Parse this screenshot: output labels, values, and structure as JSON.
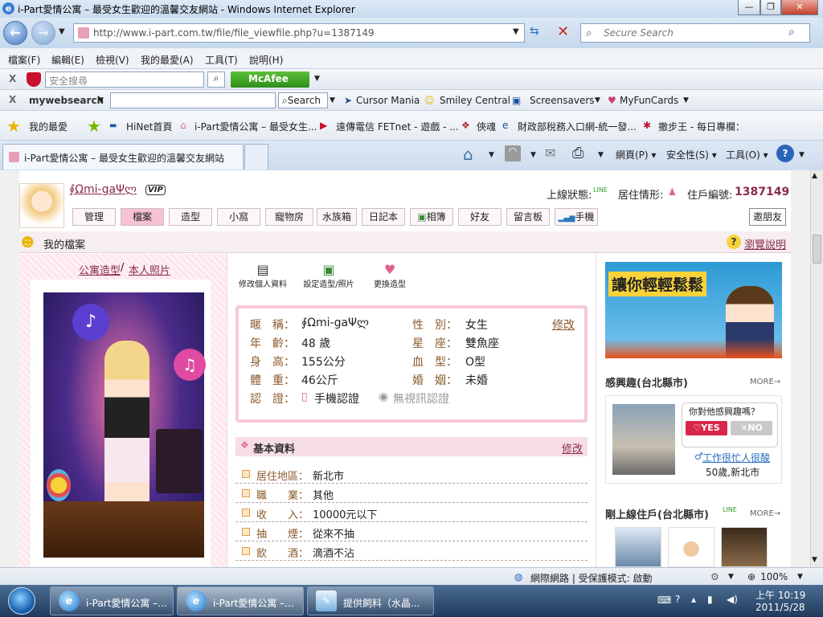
{
  "window": {
    "title": "i-Part愛情公寓 – 最受女生歡迎的溫馨交友網站 - Windows Internet Explorer"
  },
  "address": {
    "url": "http://www.i-part.com.tw/file/file_viewfile.php?u=1387149",
    "search_placeholder": "Secure Search"
  },
  "menu": [
    "檔案(F)",
    "編輯(E)",
    "檢視(V)",
    "我的最愛(A)",
    "工具(T)",
    "說明(H)"
  ],
  "toolbar1": {
    "search_placeholder": "安全搜尋",
    "mcafee": "McAfee"
  },
  "toolbar2": {
    "brand": "mywebsearch",
    "search_btn": "Search",
    "cursor": "Cursor Mania",
    "smiley": "Smiley Central",
    "screensavers": "Screensavers",
    "funcards": "MyFunCards"
  },
  "favbar": {
    "favorites": "我的最愛",
    "items": [
      "HiNet首頁",
      "i-Part愛情公寓 – 最受女生...",
      "遠傳電信 FETnet - 遊戲 - ...",
      "俠魂",
      "財政部稅務入口網-統一發...",
      "撤步王 - 每日專欄："
    ]
  },
  "tabs": {
    "active": "i-Part愛情公寓 – 最受女生歡迎的溫馨交友網站",
    "page_menu": "網頁(P)",
    "safety_menu": "安全性(S)",
    "tools_menu": "工具(O)"
  },
  "profile": {
    "name": "∮Ωmi-gaΨლ",
    "vip": "VIP",
    "online_label": "上線狀態:",
    "online_badge": "LINE",
    "residence_label": "居住情形:",
    "id_label": "住戶編號:",
    "id": "1387149"
  },
  "nav": [
    "管理",
    "檔案",
    "造型",
    "小窩",
    "寵物房",
    "水族箱",
    "日記本",
    "相簿",
    "好友",
    "留言板",
    "手機"
  ],
  "invite": "邀朋友",
  "file_title": "我的檔案",
  "browse_help": "瀏覽說明",
  "left": {
    "tab_style": "公寓造型",
    "tab_photo": "本人照片"
  },
  "actions": [
    "修改個人資料",
    "設定造型/照片",
    "更換造型"
  ],
  "info": {
    "nickname_label": "暱　稱：",
    "nickname": "∮Ωmi-gaΨლ",
    "gender_label": "性　別：",
    "gender": "女生",
    "edit": "修改",
    "age_label": "年　齡：",
    "age": "48 歲",
    "sign_label": "星　座：",
    "sign": "雙魚座",
    "height_label": "身　高：",
    "height": "155公分",
    "blood_label": "血　型：",
    "blood": "O型",
    "weight_label": "體　重：",
    "weight": "46公斤",
    "marital_label": "婚　姻：",
    "marital": "未婚",
    "verify_label": "認　證：",
    "phone_verify": "手機認證",
    "video_verify": "無視訊認證"
  },
  "basic": {
    "title": "基本資料",
    "edit": "修改",
    "rows": [
      {
        "label": "居住地區：",
        "value": "新北市"
      },
      {
        "label": "職　　業：",
        "value": "其他"
      },
      {
        "label": "收　　入：",
        "value": "10000元以下"
      },
      {
        "label": "抽　　煙：",
        "value": "從來不抽"
      },
      {
        "label": "飲　　酒：",
        "value": "滴酒不沾"
      }
    ]
  },
  "ad": {
    "text": "讓你輕輕鬆鬆"
  },
  "interest": {
    "title": "感興趣(台北縣市)",
    "more": "MORE",
    "question": "你對他感興趣嗎？",
    "yes": "YES",
    "no": "NO",
    "name": "工作很忙人很酸",
    "meta": "50歲,新北市"
  },
  "recent": {
    "title": "剛上線住戶(台北縣市)",
    "badge": "LINE",
    "more": "MORE"
  },
  "statusbar": {
    "zone": "網際網路 | 受保護模式: 啟動",
    "zoom": "100%"
  },
  "taskbar": {
    "buttons": [
      "i-Part愛情公寓 –...",
      "i-Part愛情公寓 –...",
      "提供飼料（水晶..."
    ],
    "time": "上午 10:19",
    "date": "2011/5/28"
  }
}
